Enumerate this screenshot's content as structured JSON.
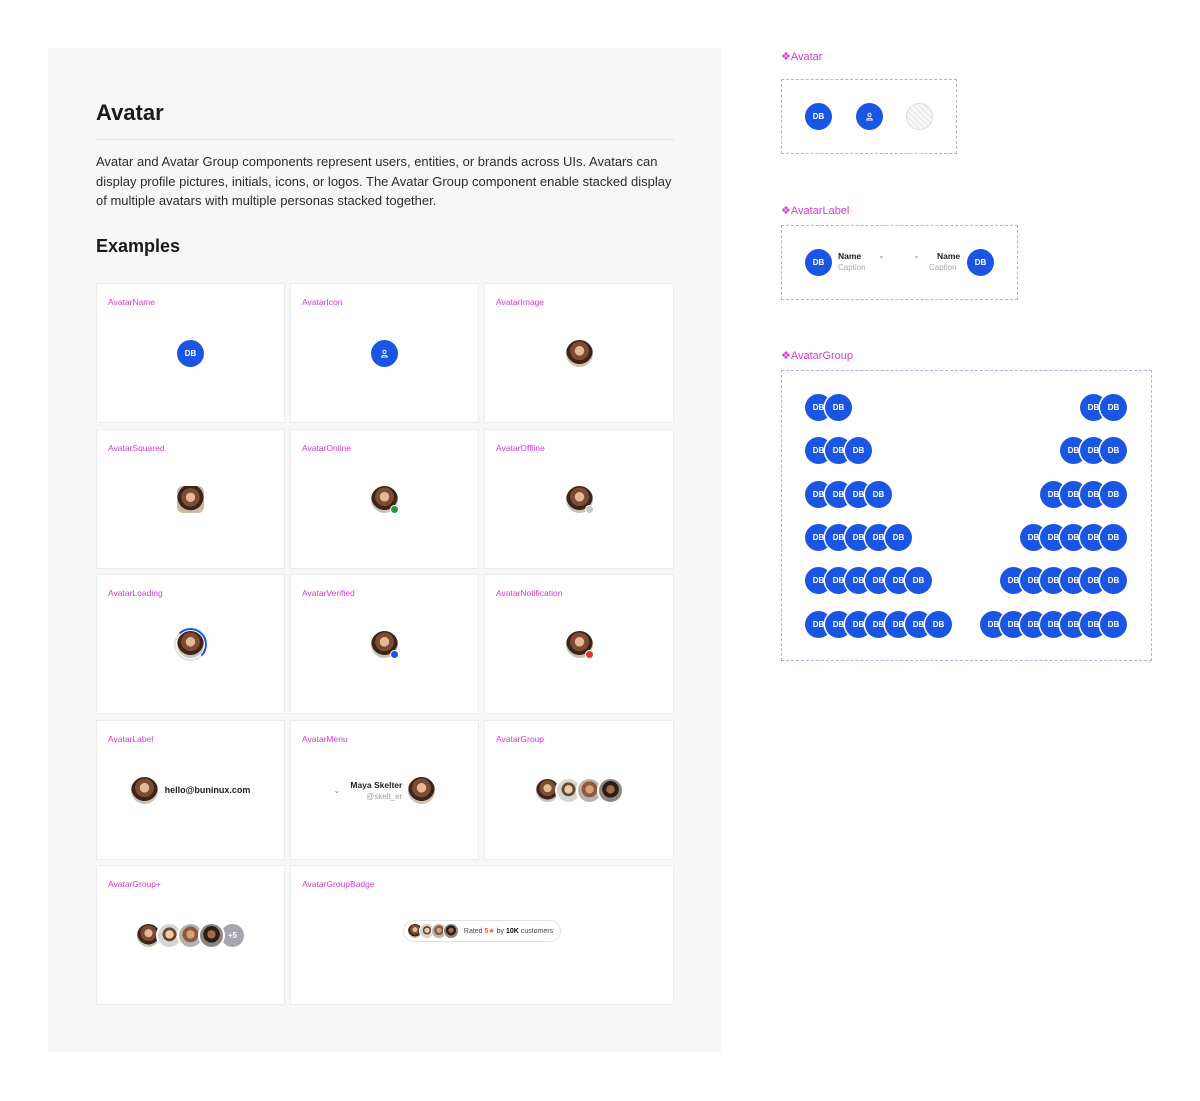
{
  "doc": {
    "title": "Avatar",
    "description": "Avatar and Avatar Group components represent users, entities, or brands across UIs. Avatars can display profile pictures, initials, icons, or logos. The Avatar Group component enable stacked display of multiple avatars with multiple personas stacked together.",
    "examples_title": "Examples",
    "cards": {
      "avatar_name": {
        "label": "AvatarName",
        "initials": "DB"
      },
      "avatar_icon": {
        "label": "AvatarIcon",
        "icon": "person-icon"
      },
      "avatar_image": {
        "label": "AvatarImage"
      },
      "avatar_squared": {
        "label": "AvatarSquared"
      },
      "avatar_online": {
        "label": "AvatarOnline"
      },
      "avatar_offline": {
        "label": "AvatarOffline"
      },
      "avatar_loading": {
        "label": "AvatarLoading"
      },
      "avatar_verified": {
        "label": "AvatarVerified",
        "icon": "check-icon"
      },
      "avatar_notification": {
        "label": "AvatarNotification"
      },
      "avatar_label": {
        "label": "AvatarLabel",
        "email": "hello@buninux.com"
      },
      "avatar_menu": {
        "label": "AvatarMenu",
        "name": "Maya Skelter",
        "handle": "@skelt_er",
        "icon": "chevron-down-icon"
      },
      "avatar_group": {
        "label": "AvatarGroup"
      },
      "avatar_group_plus": {
        "label": "AvatarGroup+",
        "overflow": "+5"
      },
      "avatar_group_badge": {
        "label": "AvatarGroupBadge",
        "rated_prefix": "Rated",
        "rating": "5★",
        "by": "by",
        "count": "10K",
        "suffix": "customers"
      }
    }
  },
  "components": {
    "avatar": {
      "title": "❖Avatar",
      "initials": "DB",
      "icon": "person-icon"
    },
    "avatar_label": {
      "title": "❖AvatarLabel",
      "initials": "DB",
      "name": "Name",
      "caption": "Caption",
      "icon": "chevron-down-icon"
    },
    "avatar_group": {
      "title": "❖AvatarGroup",
      "initials": "DB",
      "rows": [
        2,
        3,
        4,
        5,
        6,
        7
      ]
    }
  },
  "colors": {
    "accent": "#1a55e3",
    "label_magenta": "#d63ad6",
    "frame_dash": "#b9a9f0",
    "panel_bg": "#f7f7f7"
  }
}
